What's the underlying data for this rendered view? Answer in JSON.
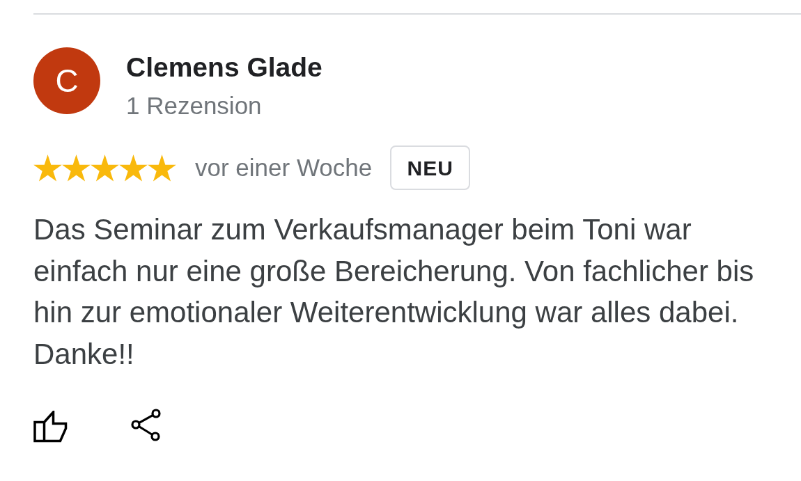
{
  "review": {
    "author": {
      "avatar_letter": "C",
      "name": "Clemens Glade",
      "review_count": "1 Rezension"
    },
    "stars": 5,
    "time": "vor einer Woche",
    "badge": "NEU",
    "text": "Das Seminar zum Verkaufsmanager beim Toni war einfach nur eine große Bereicherung. Von fachlicher bis hin zur emotionaler Weiterentwicklung war alles dabei. Danke!!"
  }
}
